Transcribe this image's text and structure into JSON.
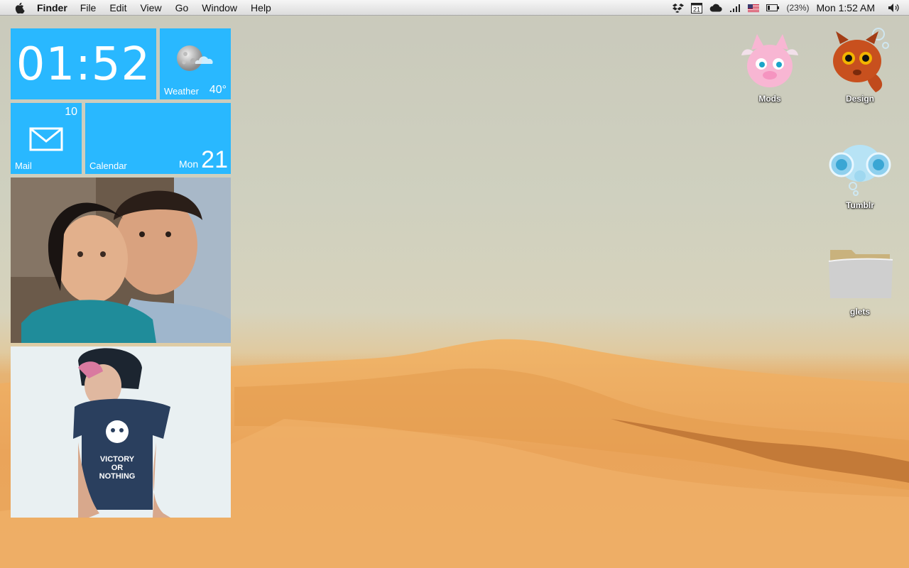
{
  "menubar": {
    "app_name": "Finder",
    "menus": [
      "File",
      "Edit",
      "View",
      "Go",
      "Window",
      "Help"
    ],
    "status": {
      "calendar_day": "21",
      "battery_percent": "(23%)",
      "clock": "Mon 1:52 AM"
    }
  },
  "tiles": {
    "clock": {
      "time": "01:52"
    },
    "weather": {
      "label": "Weather",
      "temp": "40°"
    },
    "mail": {
      "label": "Mail",
      "count": "10"
    },
    "calendar": {
      "label": "Calendar",
      "day_of_week": "Mon",
      "day": "21"
    }
  },
  "desktop_icons": [
    {
      "name": "Mods"
    },
    {
      "name": "Design"
    },
    {
      "name": "Tumblr"
    },
    {
      "name": "glets"
    }
  ],
  "photo2_shirt_text": [
    "VICTORY",
    "OR",
    "NOTHING"
  ],
  "colors": {
    "tile": "#29b8ff",
    "menubar": "#e8e8e8"
  }
}
